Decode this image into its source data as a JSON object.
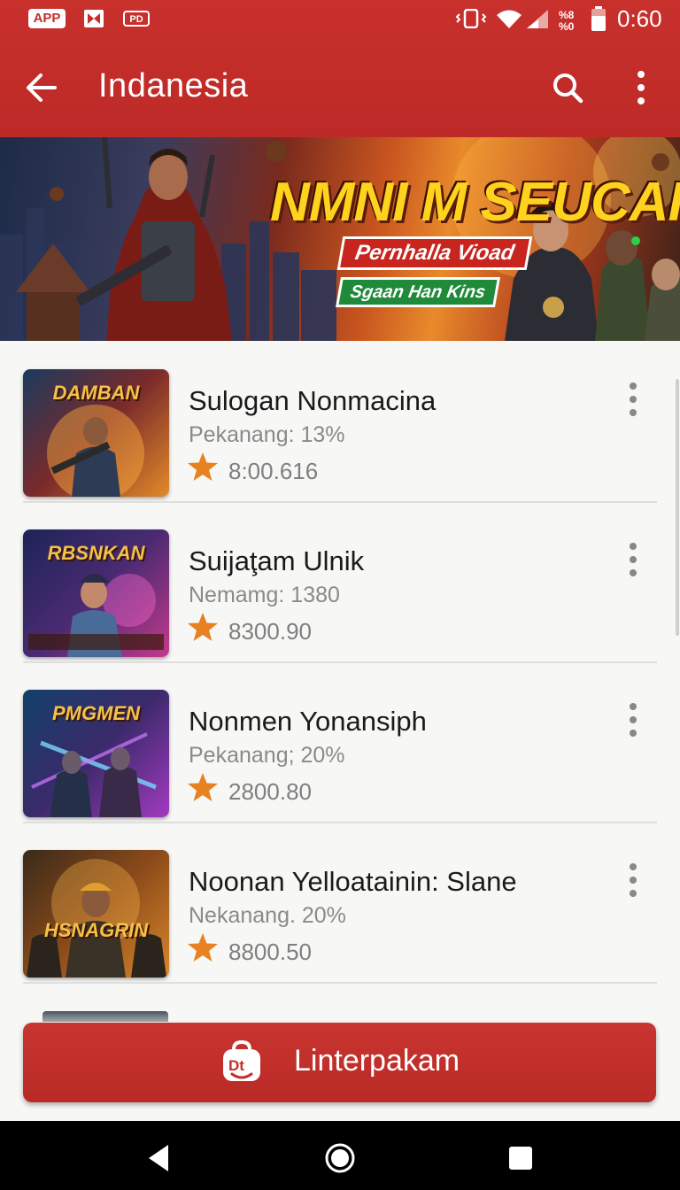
{
  "status_bar": {
    "app_badge": "APP",
    "pd_badge": "PD",
    "battery_percent": "%8\n%0",
    "time": "0:60"
  },
  "toolbar": {
    "title": "Indanesia",
    "icons": [
      "back-arrow-icon",
      "search-icon",
      "more-vert-icon"
    ]
  },
  "banner": {
    "headline": "NMNI M SEUCAH",
    "pill_primary": "Pernhalla Vioad",
    "pill_secondary": "Sgaan Han Kins"
  },
  "games": [
    {
      "thumb_title": "DAMBAN",
      "name": "Sulogan Nonmacina",
      "subtitle": "Pekanang: 13%",
      "rating": "8:00.616"
    },
    {
      "thumb_title": "RBSNKAN",
      "name": "Suijaţam Ulnik",
      "subtitle": "Nemamg: 1380",
      "rating": "8300.90"
    },
    {
      "thumb_title": "PMGMEN",
      "name": "Nonmen Yonansiph",
      "subtitle": "Pekanang; 20%",
      "rating": "2800.80"
    },
    {
      "thumb_title": "HSNAGRIN",
      "name": "Noonan Yelloatainin: Slane",
      "subtitle": "Nekanang. 20%",
      "rating": "8800.50"
    }
  ],
  "cta": {
    "label": "Linterpakam"
  },
  "colors": {
    "primary": "#c62d29",
    "star": "#e8811f"
  },
  "nav": [
    "back-triangle-icon",
    "home-circle-icon",
    "recents-square-icon"
  ]
}
